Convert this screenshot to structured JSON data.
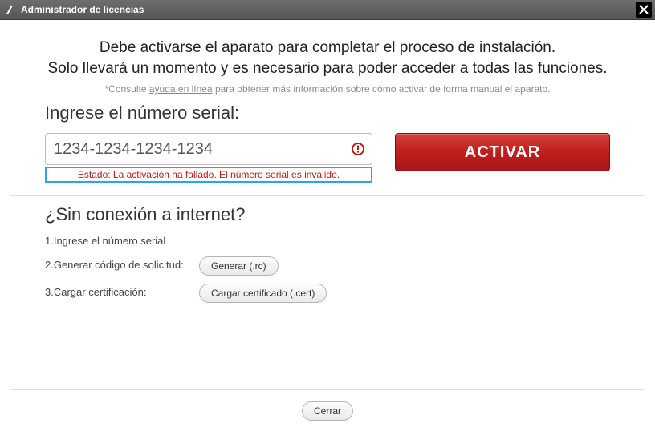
{
  "window": {
    "title": "Administrador de licencias"
  },
  "intro": {
    "line1": "Debe activarse el aparato para completar el proceso de instalación.",
    "line2": "Solo llevará un momento y es necesario para poder acceder a todas las funciones."
  },
  "help": {
    "prefix": "*Consulte ",
    "link": "ayuda en línea",
    "suffix": " para obtener más información sobre cómo activar de forma manual el aparato."
  },
  "serial": {
    "heading": "Ingrese el número serial:",
    "value": "1234-1234-1234-1234",
    "status": "Estado: La activación ha fallado. El número serial es inválido.",
    "activate_label": "ACTIVAR"
  },
  "offline": {
    "heading": "¿Sin conexión a internet?",
    "steps": [
      {
        "num": "1.",
        "label": "Ingrese el número serial"
      },
      {
        "num": "2.",
        "label": "Generar código de solicitud:",
        "button": "Generar (.rc)"
      },
      {
        "num": "3.",
        "label": "Cargar certificación:",
        "button": "Cargar certificado (.cert)"
      }
    ]
  },
  "footer": {
    "close_label": "Cerrar"
  },
  "colors": {
    "accent_red": "#c22020",
    "highlight_blue": "#2aa7e2",
    "error_text": "#c01818"
  }
}
